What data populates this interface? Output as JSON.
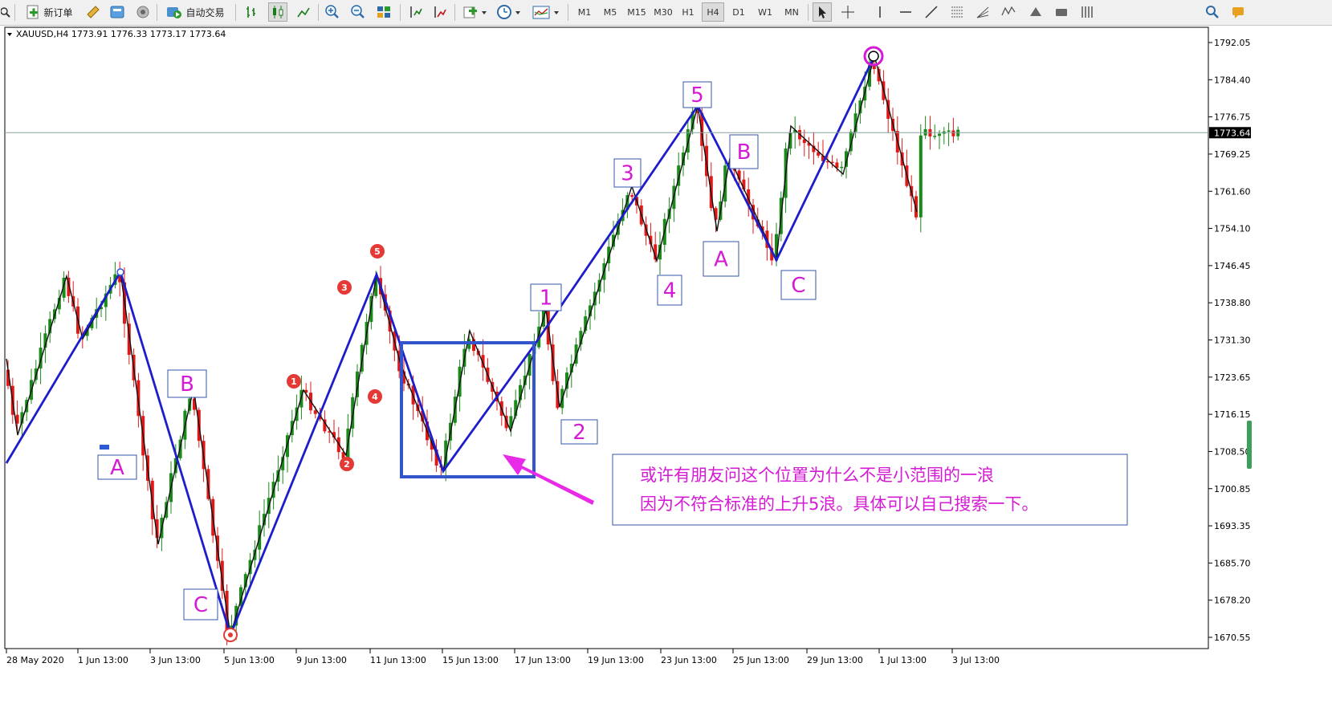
{
  "toolbar": {
    "new_order": "新订单",
    "auto_trading": "自动交易",
    "timeframes": [
      "M1",
      "M5",
      "M15",
      "M30",
      "H1",
      "H4",
      "D1",
      "W1",
      "MN"
    ],
    "active_timeframe": "H4"
  },
  "chart": {
    "header": "XAUUSD,H4  1773.91 1776.33 1773.17 1773.64",
    "symbol": "XAUUSD",
    "timeframe": "H4",
    "ohlc": {
      "open": 1773.91,
      "high": 1776.33,
      "low": 1773.17,
      "close": 1773.64
    },
    "current_price": "1773.64",
    "price_ticks": [
      "1792.05",
      "1784.40",
      "1776.75",
      "1769.25",
      "1761.60",
      "1754.10",
      "1746.45",
      "1738.80",
      "1731.30",
      "1723.65",
      "1716.15",
      "1708.50",
      "1700.85",
      "1693.35",
      "1685.70",
      "1678.20",
      "1670.55"
    ],
    "date_ticks": [
      "28 May 2020",
      "1 Jun 13:00",
      "3 Jun 13:00",
      "5 Jun 13:00",
      "9 Jun 13:00",
      "11 Jun 13:00",
      "15 Jun 13:00",
      "17 Jun 13:00",
      "19 Jun 13:00",
      "23 Jun 13:00",
      "25 Jun 13:00",
      "29 Jun 13:00",
      "1 Jul 13:00",
      "3 Jul 13:00"
    ],
    "colors": {
      "bull": "#1a8a1a",
      "bear": "#e01818",
      "wave": "#1d1dcc",
      "zigzag": "#111111",
      "label": "#d41ad4",
      "box": "#3355cc",
      "circle": "#e53935",
      "arrow": "#e82ae8"
    }
  },
  "wave_labels": {
    "A_left": "A",
    "B_left": "B",
    "C_left": "C",
    "w1": "1",
    "w2": "2",
    "w3": "3",
    "w4": "4",
    "w5": "5",
    "A_right": "A",
    "B_right": "B",
    "C_right": "C"
  },
  "sub_waves": [
    "1",
    "2",
    "3",
    "4",
    "5"
  ],
  "annotation": {
    "line1": "或许有朋友问这个位置为什么不是小范围的一浪",
    "line2": "因为不符合标准的上升5浪。具体可以自己搜索一下。"
  },
  "chart_data": {
    "type": "candlestick",
    "price_range": [
      1670.55,
      1792.05
    ],
    "wave_pivots": [
      {
        "date": "28 May 2020",
        "price": 1706.0
      },
      {
        "date": "1 Jun 13:00",
        "price": 1744.5
      },
      {
        "date": "5 Jun 13:00",
        "price": 1670.6
      },
      {
        "date": "11 Jun 13:00",
        "price": 1744.0
      },
      {
        "date": "15 Jun 13:00",
        "price": 1704.0
      },
      {
        "date": "17 Jun 13:00",
        "price": 1730.0
      },
      {
        "date": "23 Jun 13:00",
        "price": 1779.0
      },
      {
        "date": "25 Jun 13:00",
        "price": 1747.0
      },
      {
        "date": "30 Jun 13:00",
        "price": 1788.5
      }
    ]
  }
}
